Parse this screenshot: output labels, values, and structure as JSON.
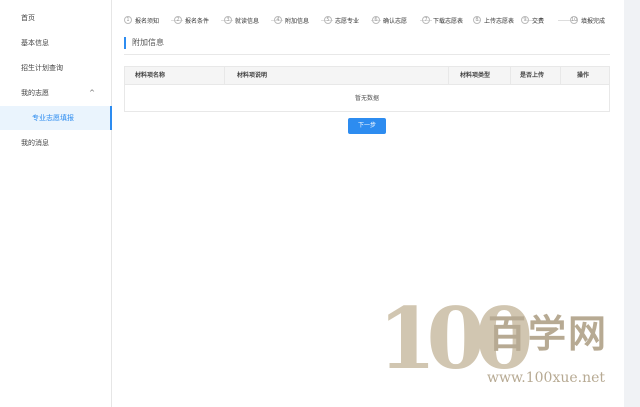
{
  "sidebar": {
    "items": [
      {
        "label": "首页"
      },
      {
        "label": "基本信息"
      },
      {
        "label": "招生计划查询"
      },
      {
        "label": "我的志愿",
        "caret": "^"
      },
      {
        "label": "专业志愿填报"
      },
      {
        "label": "我的消息"
      }
    ]
  },
  "steps": [
    {
      "num": "1",
      "label": "报名须知"
    },
    {
      "num": "2",
      "label": "报名条件"
    },
    {
      "num": "3",
      "label": "就读信息"
    },
    {
      "num": "4",
      "label": "附加信息"
    },
    {
      "num": "5",
      "label": "志愿专业"
    },
    {
      "num": "6",
      "label": "确认志愿"
    },
    {
      "num": "7",
      "label": "下载志愿表"
    },
    {
      "num": "8",
      "label": "上传志愿表"
    },
    {
      "num": "9",
      "label": "交费"
    },
    {
      "num": "10",
      "label": "填报完成"
    }
  ],
  "section": {
    "title": "附加信息"
  },
  "table": {
    "columns": [
      "材料项名称",
      "材料项说明",
      "材料项类型",
      "是否上传",
      "操作"
    ],
    "empty_text": "暂无数据"
  },
  "actions": {
    "next_label": "下一步"
  },
  "watermark": {
    "digits": "100",
    "brand": "百学网",
    "url": "www.100xue.net"
  }
}
